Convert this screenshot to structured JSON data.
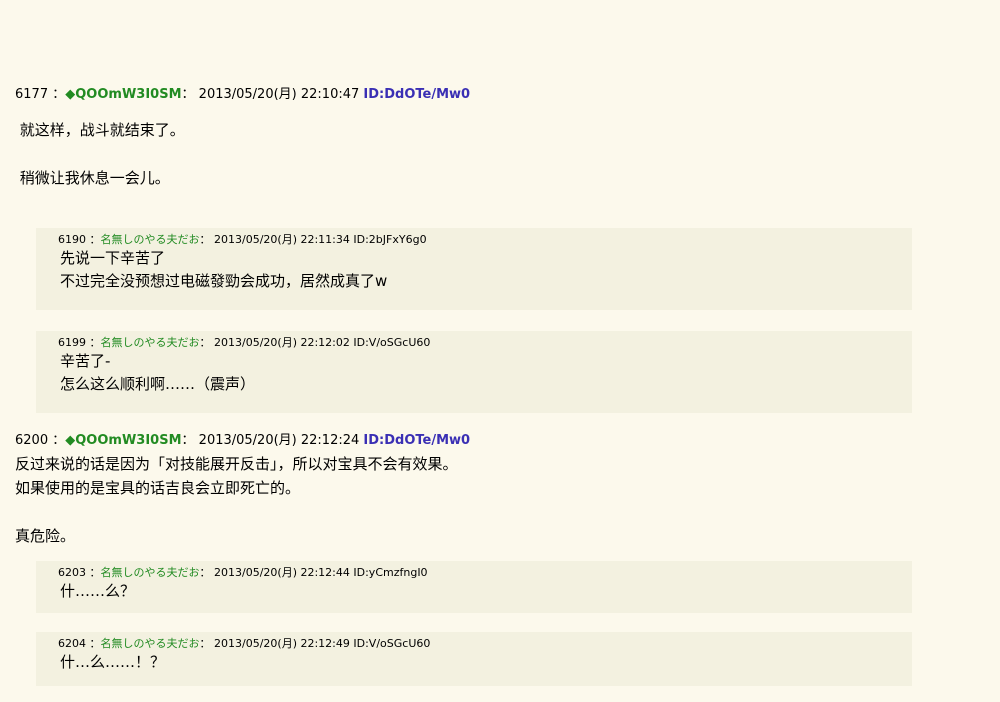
{
  "posts": [
    {
      "number": "6177",
      "sep": "：",
      "name": "◆QOOmW3I0SM",
      "sep2": "：",
      "datetime": "2013/05/20(月) 22:10:47",
      "id": "ID:DdOTe/Mw0",
      "body": " 就这样，战斗就结束了。\n\n 稍微让我休息一会儿。"
    },
    {
      "number": "6200",
      "sep": "：",
      "name": "◆QOOmW3I0SM",
      "sep2": "：",
      "datetime": "2013/05/20(月) 22:12:24",
      "id": "ID:DdOTe/Mw0",
      "body": "反过来说的话是因为「对技能展开反击」，所以对宝具不会有效果。\n如果使用的是宝具的话吉良会立即死亡的。\n\n真危险。"
    }
  ],
  "replies": [
    {
      "number": "6190",
      "sep": "：",
      "name": "名無しのやる夫だお",
      "sep2": "：",
      "datetime": "2013/05/20(月) 22:11:34",
      "id": "ID:2bJFxY6g0",
      "body": "先说一下辛苦了\n不过完全没预想过电磁發勁会成功，居然成真了w"
    },
    {
      "number": "6199",
      "sep": "：",
      "name": "名無しのやる夫だお",
      "sep2": "：",
      "datetime": "2013/05/20(月) 22:12:02",
      "id": "ID:V/oSGcU60",
      "body": "辛苦了-\n怎么这么顺利啊……（震声）"
    },
    {
      "number": "6203",
      "sep": "：",
      "name": "名無しのやる夫だお",
      "sep2": "：",
      "datetime": "2013/05/20(月) 22:12:44",
      "id": "ID:yCmzfngI0",
      "body": "什……么？"
    },
    {
      "number": "6204",
      "sep": "：",
      "name": "名無しのやる夫だお",
      "sep2": "：",
      "datetime": "2013/05/20(月) 22:12:49",
      "id": "ID:V/oSGcU60",
      "body": "什…么……！？"
    }
  ]
}
